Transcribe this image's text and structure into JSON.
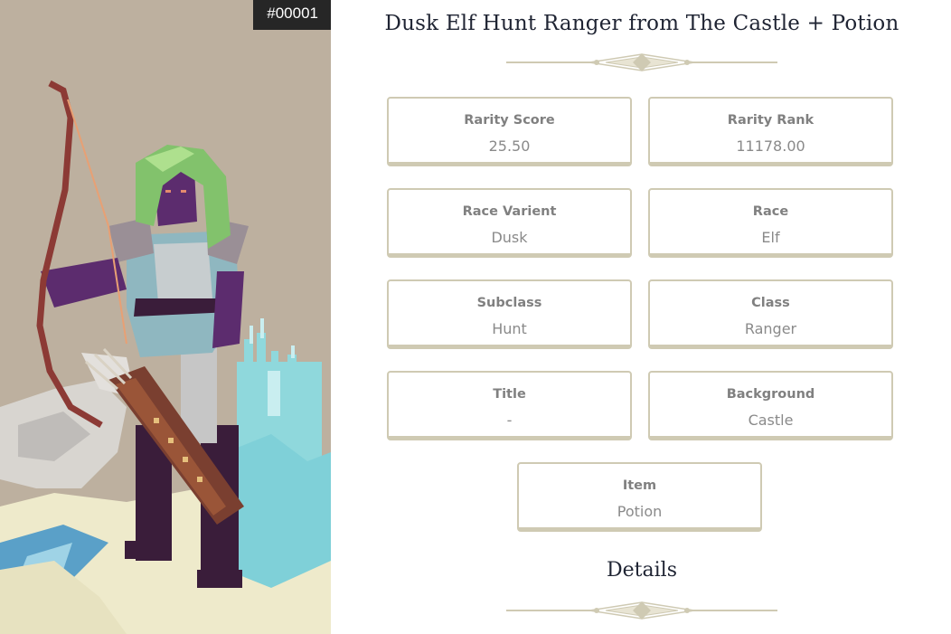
{
  "token": {
    "id_label": "#00001"
  },
  "header": {
    "title": "Dusk Elf Hunt Ranger from The Castle + Potion"
  },
  "attributes": {
    "rarity_score": {
      "label": "Rarity Score",
      "value": "25.50"
    },
    "rarity_rank": {
      "label": "Rarity Rank",
      "value": "11178.00"
    },
    "race_variant": {
      "label": "Race Varient",
      "value": "Dusk"
    },
    "race": {
      "label": "Race",
      "value": "Elf"
    },
    "subclass": {
      "label": "Subclass",
      "value": "Hunt"
    },
    "class": {
      "label": "Class",
      "value": "Ranger"
    },
    "title": {
      "label": "Title",
      "value": "-"
    },
    "background": {
      "label": "Background",
      "value": "Castle"
    },
    "item": {
      "label": "Item",
      "value": "Potion"
    }
  },
  "details": {
    "heading": "Details"
  },
  "colors": {
    "art_background": "#bdb09f",
    "card_border": "#cfcab3",
    "heading_text": "#1f2433",
    "label_text": "#808080"
  }
}
